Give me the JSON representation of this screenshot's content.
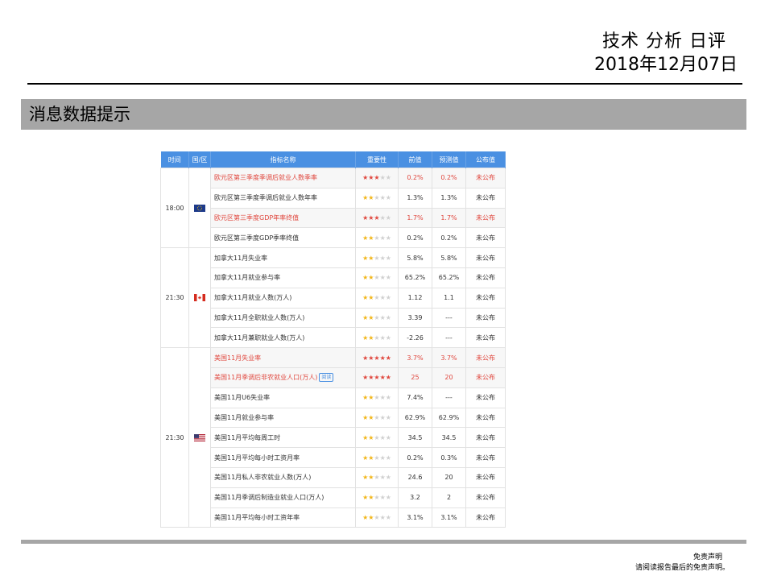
{
  "header": {
    "title": "技术 分析 日评",
    "date": "2018年12月07日"
  },
  "banner": {
    "title": "消息数据提示"
  },
  "table": {
    "columns": [
      "时间",
      "国/区",
      "指标名称",
      "重要性",
      "前值",
      "预测值",
      "公布值"
    ],
    "groups": [
      {
        "time": "18:00",
        "flag": "eu-flag",
        "rows": [
          {
            "name": "欧元区第三季度季调后就业人数季率",
            "stars": 3,
            "highlight": true,
            "prev": "0.2%",
            "forecast": "0.2%",
            "actual": "未公布"
          },
          {
            "name": "欧元区第三季度季调后就业人数年率",
            "stars": 2,
            "highlight": false,
            "prev": "1.3%",
            "forecast": "1.3%",
            "actual": "未公布"
          },
          {
            "name": "欧元区第三季度GDP年率终值",
            "stars": 3,
            "highlight": true,
            "prev": "1.7%",
            "forecast": "1.7%",
            "actual": "未公布"
          },
          {
            "name": "欧元区第三季度GDP季率终值",
            "stars": 2,
            "highlight": false,
            "prev": "0.2%",
            "forecast": "0.2%",
            "actual": "未公布"
          }
        ]
      },
      {
        "time": "21:30",
        "flag": "canada-flag",
        "rows": [
          {
            "name": "加拿大11月失业率",
            "stars": 2,
            "highlight": false,
            "prev": "5.8%",
            "forecast": "5.8%",
            "actual": "未公布"
          },
          {
            "name": "加拿大11月就业参与率",
            "stars": 2,
            "highlight": false,
            "prev": "65.2%",
            "forecast": "65.2%",
            "actual": "未公布"
          },
          {
            "name": "加拿大11月就业人数(万人)",
            "stars": 2,
            "highlight": false,
            "prev": "1.12",
            "forecast": "1.1",
            "actual": "未公布"
          },
          {
            "name": "加拿大11月全职就业人数(万人)",
            "stars": 2,
            "highlight": false,
            "prev": "3.39",
            "forecast": "---",
            "actual": "未公布"
          },
          {
            "name": "加拿大11月兼职就业人数(万人)",
            "stars": 2,
            "highlight": false,
            "prev": "-2.26",
            "forecast": "---",
            "actual": "未公布"
          }
        ]
      },
      {
        "time": "21:30",
        "flag": "us-flag",
        "rows": [
          {
            "name": "美国11月失业率",
            "stars": 5,
            "highlight": true,
            "prev": "3.7%",
            "forecast": "3.7%",
            "actual": "未公布"
          },
          {
            "name": "美国11月季调后非农就业人口(万人)",
            "stars": 5,
            "highlight": true,
            "tag": "阅读",
            "prev": "25",
            "forecast": "20",
            "actual": "未公布"
          },
          {
            "name": "美国11月U6失业率",
            "stars": 2,
            "highlight": false,
            "prev": "7.4%",
            "forecast": "---",
            "actual": "未公布"
          },
          {
            "name": "美国11月就业参与率",
            "stars": 2,
            "highlight": false,
            "prev": "62.9%",
            "forecast": "62.9%",
            "actual": "未公布"
          },
          {
            "name": "美国11月平均每周工时",
            "stars": 2,
            "highlight": false,
            "prev": "34.5",
            "forecast": "34.5",
            "actual": "未公布"
          },
          {
            "name": "美国11月平均每小时工资月率",
            "stars": 2,
            "highlight": false,
            "prev": "0.2%",
            "forecast": "0.3%",
            "actual": "未公布"
          },
          {
            "name": "美国11月私人非农就业人数(万人)",
            "stars": 2,
            "highlight": false,
            "prev": "24.6",
            "forecast": "20",
            "actual": "未公布"
          },
          {
            "name": "美国11月季调后制造业就业人口(万人)",
            "stars": 2,
            "highlight": false,
            "prev": "3.2",
            "forecast": "2",
            "actual": "未公布"
          },
          {
            "name": "美国11月平均每小时工资年率",
            "stars": 2,
            "highlight": false,
            "prev": "3.1%",
            "forecast": "3.1%",
            "actual": "未公布"
          }
        ]
      }
    ]
  },
  "footer": {
    "line1": "免责声明",
    "line2": "请阅读报告最后的免责声明。"
  },
  "colors": {
    "header_blue": "#4a90e2",
    "highlight_red": "#e0473e",
    "star_yellow": "#f2b619",
    "banner_gray": "#a6a6a6"
  }
}
